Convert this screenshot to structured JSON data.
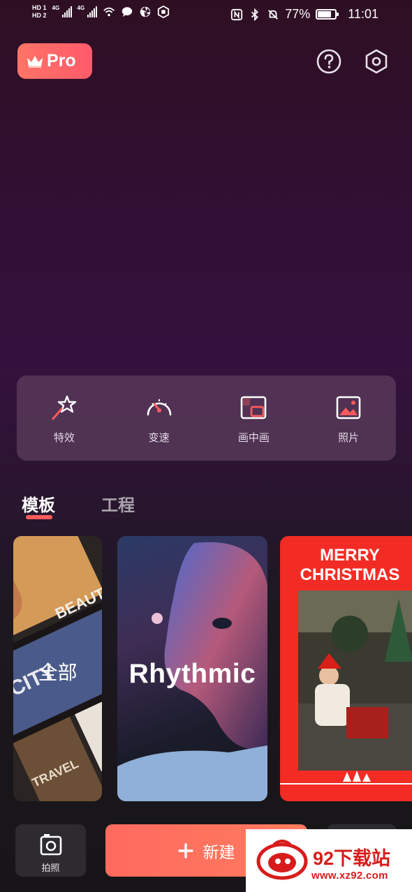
{
  "status_bar": {
    "hd1": "HD 1",
    "hd2": "HD 2",
    "net1": "4G",
    "net2": "4G",
    "battery_percent": "77%",
    "battery_level": 0.77,
    "time": "11:01"
  },
  "header": {
    "pro_label": "Pro",
    "help_icon": "question-circle-icon",
    "settings_icon": "hexagon-gear-icon"
  },
  "tools": [
    {
      "label": "特效",
      "icon": "magic-wand-star-icon"
    },
    {
      "label": "变速",
      "icon": "speedometer-icon"
    },
    {
      "label": "画中画",
      "icon": "picture-in-picture-icon"
    },
    {
      "label": "照片",
      "icon": "image-icon"
    }
  ],
  "tabs": [
    {
      "label": "模板",
      "active": true
    },
    {
      "label": "工程",
      "active": false
    }
  ],
  "cards": [
    {
      "title": "全部",
      "collage_tags": [
        "BEAUTY",
        "CITY",
        "TRAVEL"
      ]
    },
    {
      "title": "Rhythmic"
    },
    {
      "title": "MERRY\nCHRISTMAS"
    }
  ],
  "bottom": {
    "camera_label": "拍照",
    "new_label": "新建"
  },
  "watermark": {
    "text": "92下载站",
    "url": "www.xz92.com"
  },
  "colors": {
    "accent": "#ff5b5b",
    "pro_gradient_start": "#ff7466",
    "xmas_red": "#f22c24"
  }
}
